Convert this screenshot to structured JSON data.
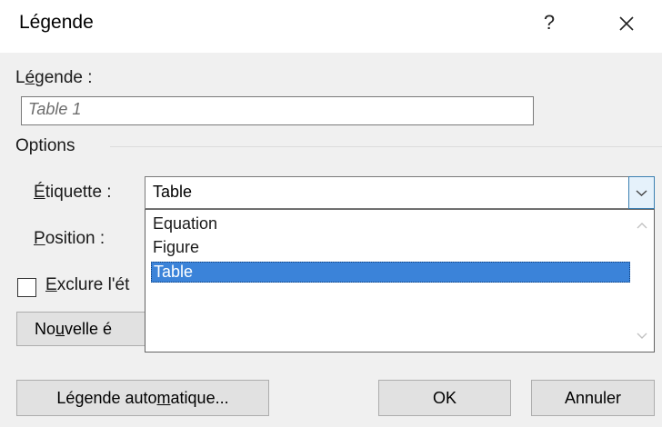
{
  "dialog": {
    "title": "Légende",
    "help": "?"
  },
  "caption": {
    "label_pre": "L",
    "label_ul": "é",
    "label_post": "gende :",
    "value": "Table 1"
  },
  "options": {
    "title": "Options",
    "label_field": {
      "label_ul": "É",
      "label_post": "tiquette :",
      "selected": "Table",
      "items": [
        "Equation",
        "Figure",
        "Table"
      ]
    },
    "position_field": {
      "label_ul": "P",
      "label_post": "osition :"
    }
  },
  "exclude": {
    "label_ul": "E",
    "label_post": "xclure l'ét",
    "checked": false
  },
  "new_label_button": {
    "pre": "No",
    "ul": "u",
    "post": "velle é"
  },
  "footer": {
    "auto_pre": "Légende auto",
    "auto_ul": "m",
    "auto_post": "atique...",
    "ok": "OK",
    "cancel": "Annuler"
  }
}
